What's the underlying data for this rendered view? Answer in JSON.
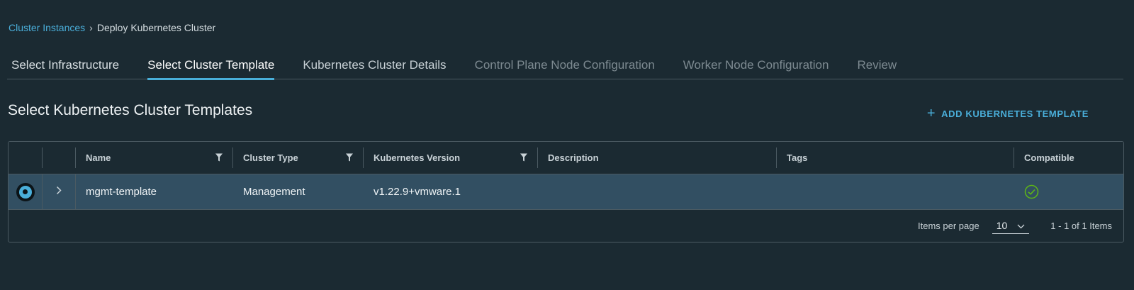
{
  "breadcrumb": {
    "link": "Cluster Instances",
    "separator": "›",
    "current": "Deploy Kubernetes Cluster"
  },
  "tabs": [
    {
      "label": "Select Infrastructure",
      "state": "done"
    },
    {
      "label": "Select Cluster Template",
      "state": "active"
    },
    {
      "label": "Kubernetes Cluster Details",
      "state": "next"
    },
    {
      "label": "Control Plane Node Configuration",
      "state": "disabled"
    },
    {
      "label": "Worker Node Configuration",
      "state": "disabled"
    },
    {
      "label": "Review",
      "state": "disabled"
    }
  ],
  "section": {
    "title": "Select Kubernetes Cluster Templates",
    "add_button": "ADD KUBERNETES TEMPLATE",
    "add_icon": "plus-icon"
  },
  "table": {
    "columns": {
      "name": "Name",
      "cluster_type": "Cluster Type",
      "k8s_version": "Kubernetes Version",
      "description": "Description",
      "tags": "Tags",
      "compatible": "Compatible"
    },
    "rows": [
      {
        "selected": true,
        "name": "mgmt-template",
        "cluster_type": "Management",
        "k8s_version": "v1.22.9+vmware.1",
        "description": "",
        "tags": "",
        "compatible_icon": "check-circle-icon"
      }
    ],
    "footer": {
      "items_per_page_label": "Items per page",
      "items_per_page_value": "10",
      "range": "1 - 1 of 1 Items"
    }
  },
  "colors": {
    "background": "#1b2a32",
    "accent": "#4aaed9",
    "selected_row": "#324f62",
    "success": "#5eb715"
  }
}
